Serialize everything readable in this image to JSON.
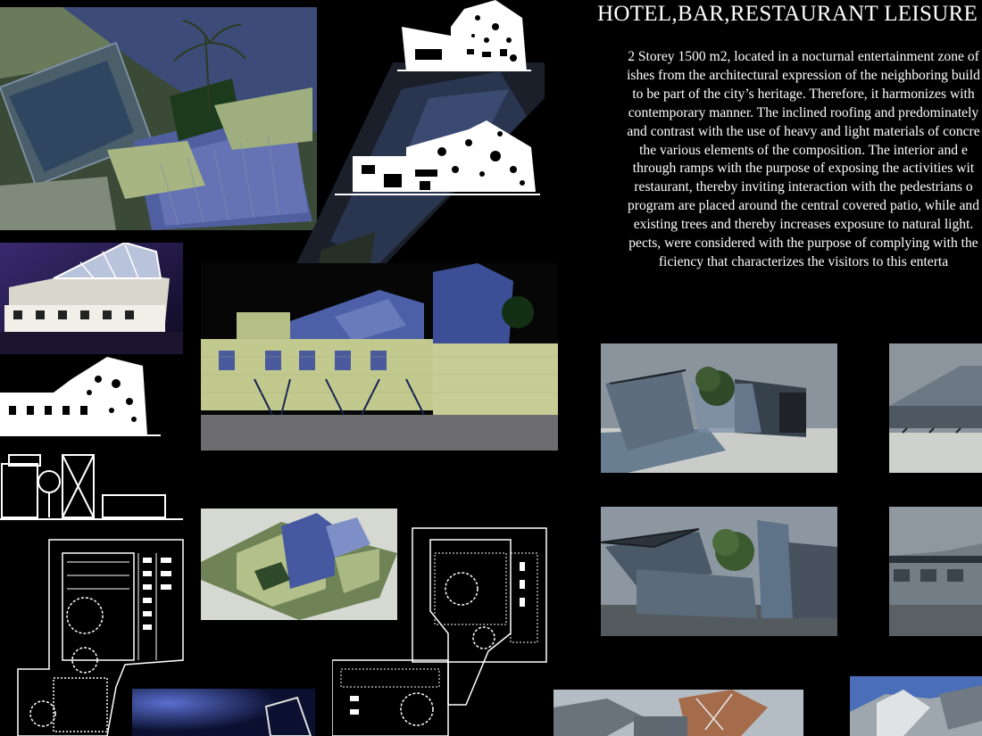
{
  "board": {
    "title": "HOTEL,BAR,RESTAURANT LEISURE",
    "description_lines": [
      "2 Storey 1500 m2, located in a nocturnal entertainment zone of",
      "ishes from the architectural expression of the neighboring build",
      "to be part of the city’s heritage.  Therefore, it harmonizes with",
      "contemporary manner.  The inclined roofing and predominately",
      "and contrast with the use of heavy and light materials of concre",
      "the various elements of the composition.  The interior and e",
      "through ramps with the purpose of exposing the activities wit",
      "restaurant, thereby inviting interaction with the pedestrians o",
      "program are placed around the central covered patio, while and",
      "existing trees and thereby increases exposure to natural light.",
      "pects, were considered with the purpose of complying with the",
      "ficiency that characterizes the visitors to this enterta"
    ]
  },
  "colors": {
    "background": "#000000",
    "render_sky": "#5b6670",
    "glass_blue": "#3d4f8c",
    "facade_green": "#b6bf8e",
    "drawing_white": "#ffffff"
  }
}
